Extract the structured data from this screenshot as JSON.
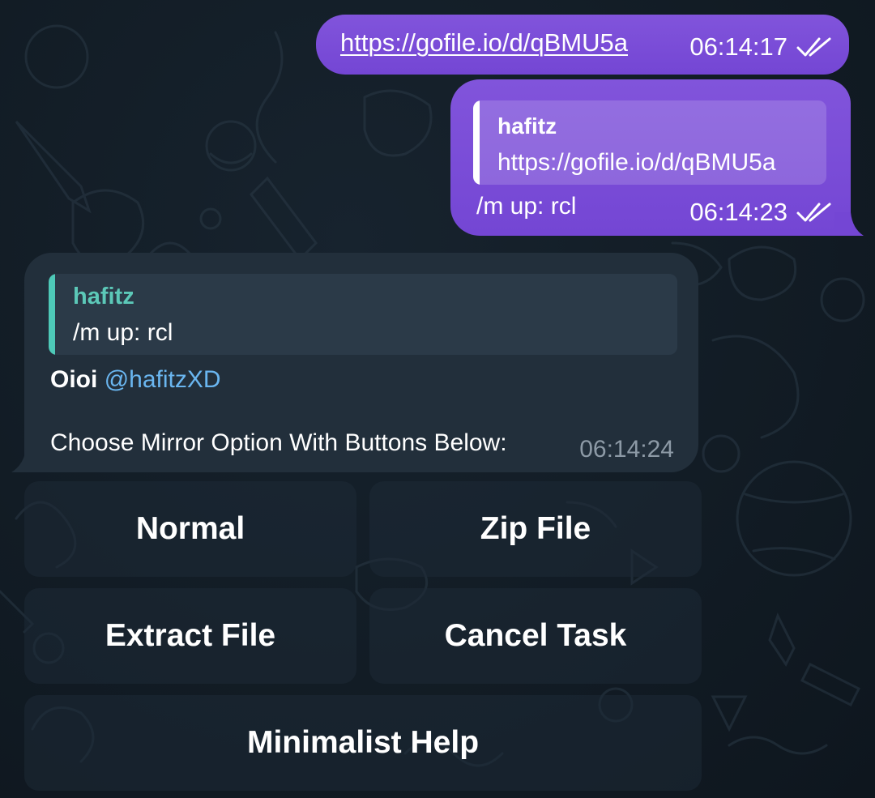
{
  "messages": {
    "first": {
      "link": "https://gofile.io/d/qBMU5a",
      "time": "06:14:17"
    },
    "second": {
      "reply_name": "hafitz",
      "reply_text": "https://gofile.io/d/qBMU5a",
      "text": "/m up: rcl",
      "time": "06:14:23"
    },
    "bot_reply": {
      "reply_name": "hafitz",
      "reply_text": "/m up: rcl",
      "greeting": "Oioi",
      "mention": "@hafitzXD",
      "instruction": "Choose Mirror Option With Buttons Below:",
      "time": "06:14:24"
    }
  },
  "keyboard": {
    "normal": "Normal",
    "zip": "Zip File",
    "extract": "Extract File",
    "cancel": "Cancel Task",
    "help": "Minimalist Help"
  },
  "colors": {
    "outgoing_bubble": "#7b4fd6",
    "incoming_bubble": "#222f3b",
    "reply_accent": "#4ec9b8",
    "mention": "#6ab6f0",
    "background": "#121c25"
  },
  "icons": {
    "read_status": "double-check-icon"
  }
}
